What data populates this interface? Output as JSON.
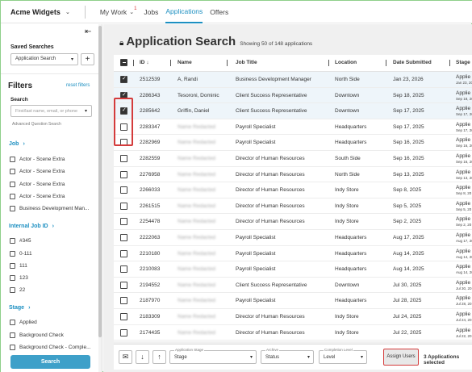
{
  "app": {
    "brand": "Acme Widgets"
  },
  "nav": {
    "items": [
      {
        "label": "My Work",
        "badge": "1"
      },
      {
        "label": "Jobs"
      },
      {
        "label": "Applications"
      },
      {
        "label": "Offers"
      }
    ]
  },
  "sidebar": {
    "saved_title": "Saved Searches",
    "saved_value": "Application Search",
    "filters_title": "Filters",
    "reset": "reset filters",
    "search_label": "Search",
    "search_placeholder": "First/last name, email, or phone",
    "advanced": "Advanced Question Search",
    "job_title": "Job",
    "job_items": [
      "Actor - Scene Extra",
      "Actor - Scene Extra",
      "Actor - Scene Extra",
      "Actor - Scene Extra",
      "Business Development Man..."
    ],
    "internal_title": "Internal Job ID",
    "internal_items": [
      "#345",
      "0-111",
      "111",
      "123",
      "22"
    ],
    "stage_title": "Stage",
    "stage_items": [
      "Applied",
      "Background Check",
      "Background Check - Comple..."
    ],
    "search_button": "Search"
  },
  "main": {
    "title": "Application Search",
    "count": "Showing 50 of 148 applications",
    "columns": {
      "id": "ID",
      "name": "Name",
      "job": "Job Title",
      "location": "Location",
      "date": "Date Submitted",
      "stage": "Stage"
    },
    "rows": [
      {
        "checked": true,
        "id": "2512539",
        "name": "A, Randi",
        "job": "Business Development Manager",
        "location": "North Side",
        "date": "Jan 23, 2026",
        "stage": "Applie",
        "stage_sub": "Jan 23, 20"
      },
      {
        "checked": true,
        "id": "2286343",
        "name": "Tesoroni, Dominic",
        "job": "Client Success Representative",
        "location": "Downtown",
        "date": "Sep 18, 2025",
        "stage": "Applie",
        "stage_sub": "Sep 18, 20"
      },
      {
        "checked": true,
        "id": "2285642",
        "name": "Griffin, Daniel",
        "job": "Client Success Representative",
        "location": "Downtown",
        "date": "Sep 17, 2025",
        "stage": "Applie",
        "stage_sub": "Sep 17, 20"
      },
      {
        "checked": false,
        "id": "2283347",
        "name": "Name Redacted",
        "job": "Payroll Specialist",
        "location": "Headquarters",
        "date": "Sep 17, 2025",
        "stage": "Applie",
        "stage_sub": "Sep 17, 20"
      },
      {
        "checked": false,
        "id": "2282969",
        "name": "Name Redacted",
        "job": "Payroll Specialist",
        "location": "Headquarters",
        "date": "Sep 16, 2025",
        "stage": "Applie",
        "stage_sub": "Sep 16, 20"
      },
      {
        "checked": false,
        "id": "2282559",
        "name": "Name Redacted",
        "job": "Director of Human Resources",
        "location": "South Side",
        "date": "Sep 16, 2025",
        "stage": "Applie",
        "stage_sub": "Sep 16, 20"
      },
      {
        "checked": false,
        "id": "2276958",
        "name": "Name Redacted",
        "job": "Director of Human Resources",
        "location": "North Side",
        "date": "Sep 13, 2025",
        "stage": "Applie",
        "stage_sub": "Sep 13, 20"
      },
      {
        "checked": false,
        "id": "2266033",
        "name": "Name Redacted",
        "job": "Director of Human Resources",
        "location": "Indy Store",
        "date": "Sep 8, 2025",
        "stage": "Applie",
        "stage_sub": "Sep 8, 20"
      },
      {
        "checked": false,
        "id": "2261515",
        "name": "Name Redacted",
        "job": "Director of Human Resources",
        "location": "Indy Store",
        "date": "Sep 5, 2025",
        "stage": "Applie",
        "stage_sub": "Sep 5, 20"
      },
      {
        "checked": false,
        "id": "2254478",
        "name": "Name Redacted",
        "job": "Director of Human Resources",
        "location": "Indy Store",
        "date": "Sep 2, 2025",
        "stage": "Applie",
        "stage_sub": "Sep 2, 20"
      },
      {
        "checked": false,
        "id": "2222063",
        "name": "Name Redacted",
        "job": "Payroll Specialist",
        "location": "Headquarters",
        "date": "Aug 17, 2025",
        "stage": "Applie",
        "stage_sub": "Aug 17, 20"
      },
      {
        "checked": false,
        "id": "2210180",
        "name": "Name Redacted",
        "job": "Payroll Specialist",
        "location": "Headquarters",
        "date": "Aug 14, 2025",
        "stage": "Applie",
        "stage_sub": "Aug 14, 20"
      },
      {
        "checked": false,
        "id": "2210083",
        "name": "Name Redacted",
        "job": "Payroll Specialist",
        "location": "Headquarters",
        "date": "Aug 14, 2025",
        "stage": "Applie",
        "stage_sub": "Aug 14, 20"
      },
      {
        "checked": false,
        "id": "2194552",
        "name": "Name Redacted",
        "job": "Client Success Representative",
        "location": "Downtown",
        "date": "Jul 30, 2025",
        "stage": "Applie",
        "stage_sub": "Jul 30, 20"
      },
      {
        "checked": false,
        "id": "2187970",
        "name": "Name Redacted",
        "job": "Payroll Specialist",
        "location": "Headquarters",
        "date": "Jul 28, 2025",
        "stage": "Applie",
        "stage_sub": "Jul 28, 20"
      },
      {
        "checked": false,
        "id": "2183309",
        "name": "Name Redacted",
        "job": "Director of Human Resources",
        "location": "Indy Store",
        "date": "Jul 24, 2025",
        "stage": "Applie",
        "stage_sub": "Jul 24, 20"
      },
      {
        "checked": false,
        "id": "2174435",
        "name": "Name Redacted",
        "job": "Director of Human Resources",
        "location": "Indy Store",
        "date": "Jul 22, 2025",
        "stage": "Applie",
        "stage_sub": "Jul 22, 20"
      }
    ]
  },
  "footer": {
    "stage_label": "Application Stage",
    "stage_value": "Stage",
    "archive_label": "Archive",
    "archive_value": "Status",
    "completion_label": "Completion Level",
    "completion_value": "Level",
    "assign": "Assign Users",
    "selected": "3 Applications selected"
  },
  "colors": {
    "accent": "#1c8fc1",
    "button": "#3ea0c9",
    "highlight": "#d43b3b"
  }
}
